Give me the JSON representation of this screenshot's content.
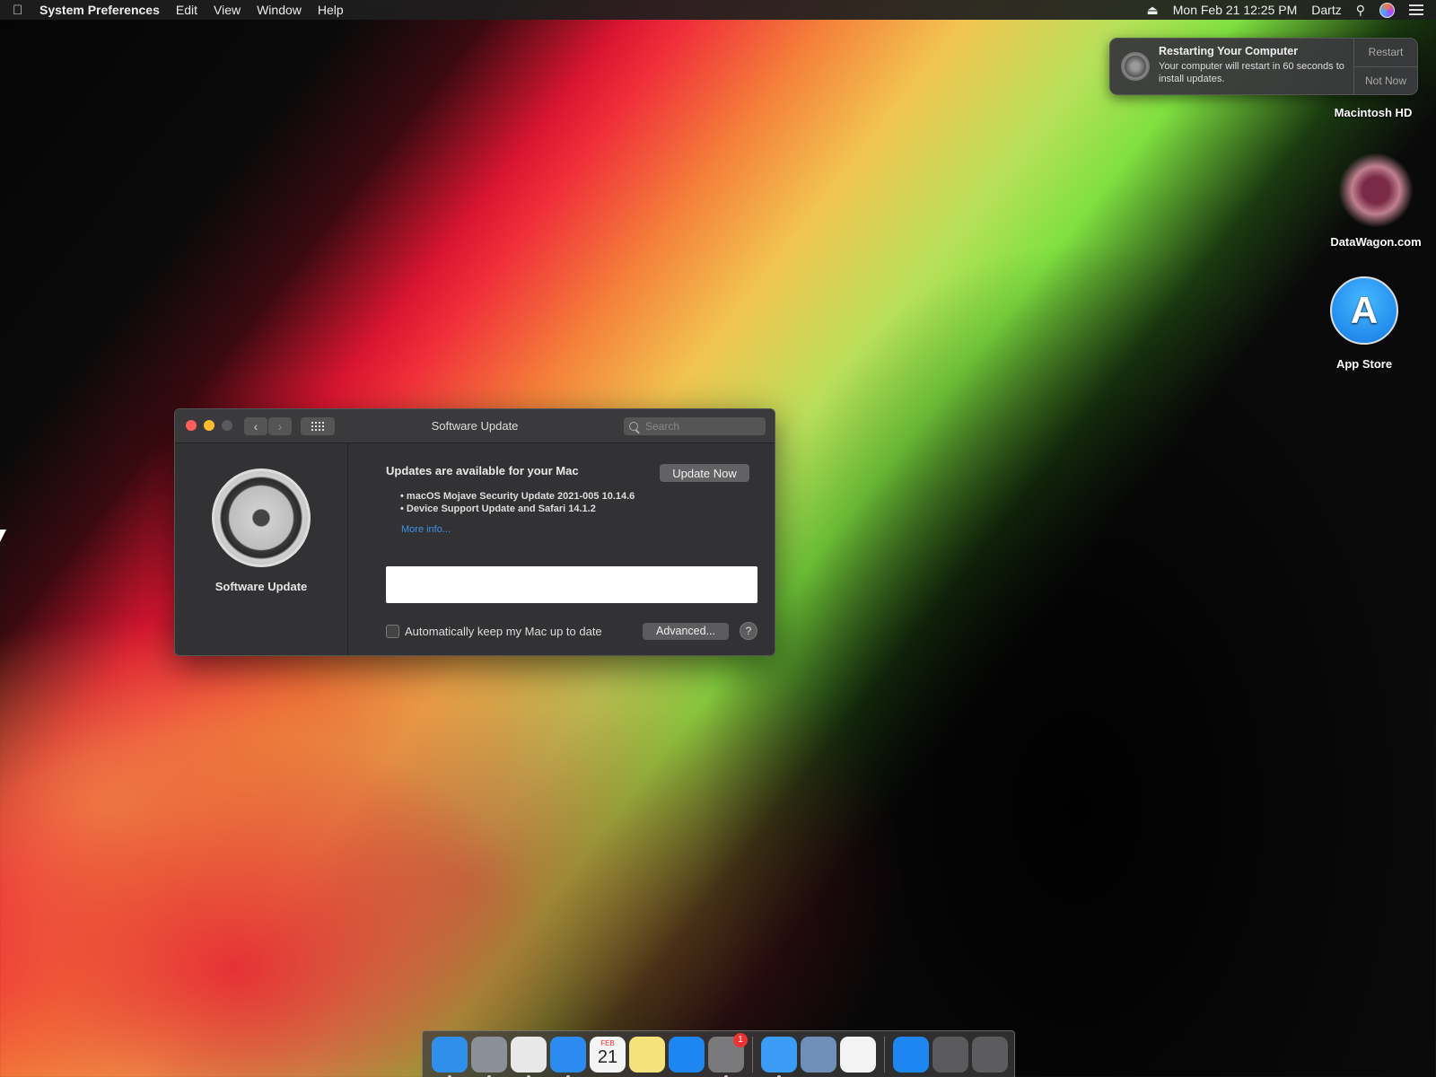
{
  "menubar": {
    "app_name": "System Preferences",
    "menus": [
      "Edit",
      "View",
      "Window",
      "Help"
    ],
    "datetime": "Mon Feb 21  12:25 PM",
    "user": "Dartz"
  },
  "notification": {
    "title": "Restarting Your Computer",
    "body": "Your computer will restart in 60 seconds to install updates.",
    "action_primary": "Restart",
    "action_secondary": "Not Now"
  },
  "desktop": {
    "icons": [
      {
        "label": "Macintosh HD",
        "icon": "hard-drive-icon"
      },
      {
        "label": "DataWagon.com",
        "icon": "datawagon-icon"
      },
      {
        "label": "App Store",
        "icon": "app-store-icon"
      }
    ]
  },
  "window": {
    "title": "Software Update",
    "search_placeholder": "Search",
    "sidebar_label": "Software Update",
    "heading": "Updates are available for your Mac",
    "update_now_label": "Update Now",
    "updates": [
      "macOS Mojave Security Update 2021-005 10.14.6",
      "Device Support Update  and Safari 14.1.2"
    ],
    "more_info": "More info...",
    "auto_update_label": "Automatically keep my Mac up to date",
    "auto_update_checked": false,
    "advanced_label": "Advanced...",
    "help_label": "?"
  },
  "dock": {
    "apps": [
      {
        "name": "finder-icon",
        "color": "#2f8fea"
      },
      {
        "name": "launchpad-icon",
        "color": "#8a8f98"
      },
      {
        "name": "chrome-icon",
        "color": "#e8e8e8"
      },
      {
        "name": "safari-icon",
        "color": "#2b8bf0"
      },
      {
        "name": "calendar-icon",
        "color": "#f4f4f4"
      },
      {
        "name": "notes-icon",
        "color": "#f6e27a"
      },
      {
        "name": "app-store-icon",
        "color": "#1d86f0"
      },
      {
        "name": "system-preferences-icon",
        "color": "#7a7a7c"
      },
      {
        "name": "messages-icon",
        "color": "#3a9cf5"
      },
      {
        "name": "preview-icon",
        "color": "#6f8fb8"
      },
      {
        "name": "photos-icon",
        "color": "#f3f3f3"
      },
      {
        "name": "app-store-icon",
        "color": "#1d86f0"
      },
      {
        "name": "downloads-stack-icon",
        "color": "#5a5a5c"
      },
      {
        "name": "trash-icon",
        "color": "#5c5c5e"
      }
    ],
    "calendar_month": "FEB",
    "calendar_day": "21",
    "sysprefs_badge": "1"
  }
}
